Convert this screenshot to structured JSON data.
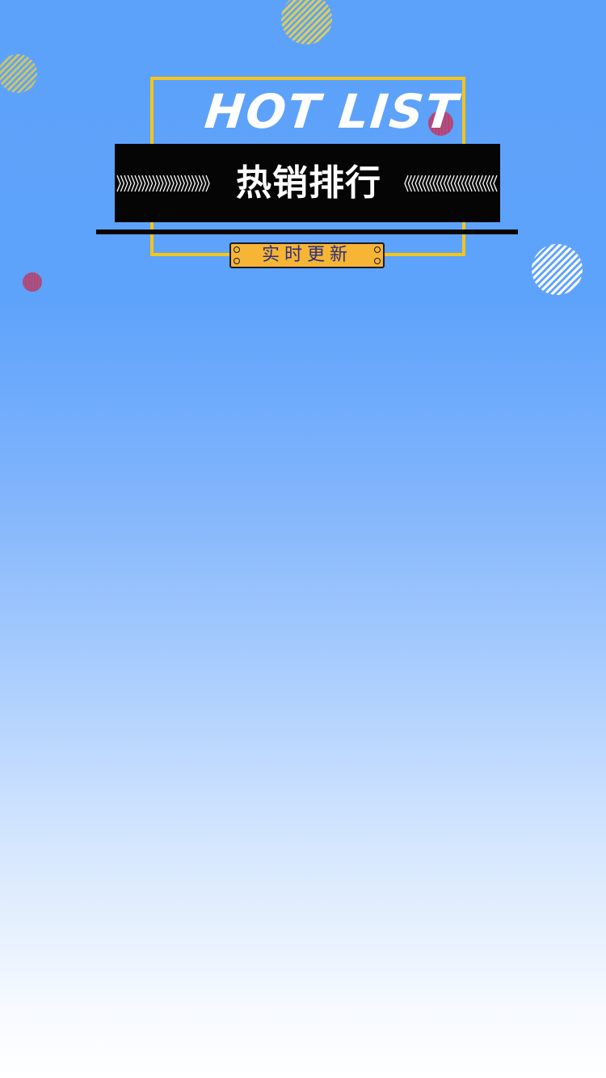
{
  "header": {
    "title_en": "HOT LIST",
    "title_cn": "热销排行",
    "tag": "实时更新"
  },
  "colors": {
    "background_top": "#5da2fa",
    "background_bottom": "#ffffff",
    "frame": "#f5c51a",
    "banner": "#050505",
    "tag_fill": "#f6b534",
    "tag_text": "#2b2d80",
    "dot_red": "#c63c67",
    "dot_yellow": "#d9cc5e"
  },
  "icons": {
    "left_chevrons": "chevron-right-pattern",
    "right_chevrons": "chevron-left-pattern"
  }
}
